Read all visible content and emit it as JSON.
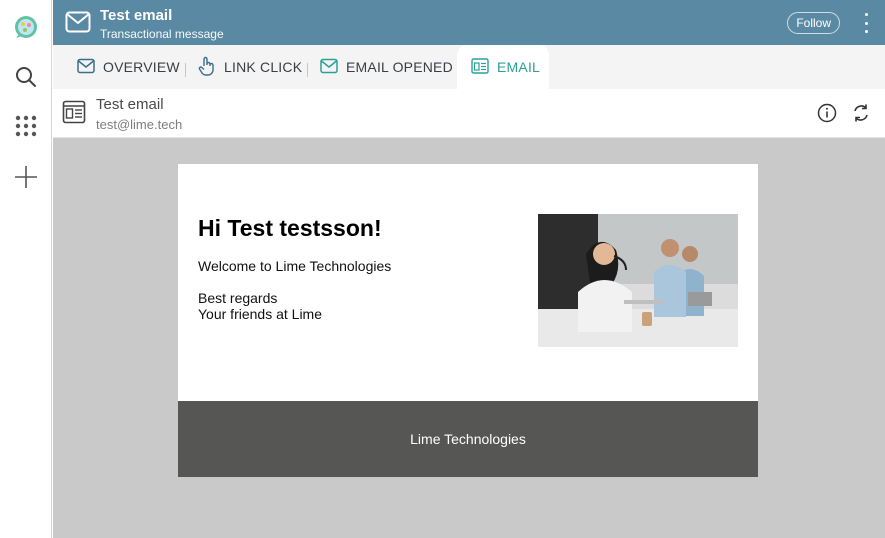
{
  "header": {
    "title": "Test email",
    "subtitle": "Transactional message",
    "follow_label": "Follow",
    "color": "#5a8aa3"
  },
  "rail": {
    "icons": [
      "lime-logo-icon",
      "search-icon",
      "apps-grid-icon",
      "plus-icon"
    ]
  },
  "tabs": [
    {
      "label": "OVERVIEW",
      "icon": "mail-icon",
      "active": false
    },
    {
      "label": "LINK CLICK",
      "icon": "pointer-hand-icon",
      "active": false
    },
    {
      "label": "EMAIL OPENED",
      "icon": "mail-open-icon",
      "active": false
    },
    {
      "label": "EMAIL",
      "icon": "newsletter-icon",
      "active": true
    }
  ],
  "record": {
    "name": "Test email",
    "address": "test@lime.tech"
  },
  "email_preview": {
    "greeting": "Hi Test testsson!",
    "body": "Welcome to Lime Technologies",
    "signoff_1": "Best regards",
    "signoff_2": "Your friends at Lime",
    "footer": "Lime Technologies"
  },
  "colors": {
    "accent": "#2ba196",
    "active_tab_bg": "#d7eef0",
    "canvas": "#c9c9c9",
    "email_footer": "#565655"
  }
}
